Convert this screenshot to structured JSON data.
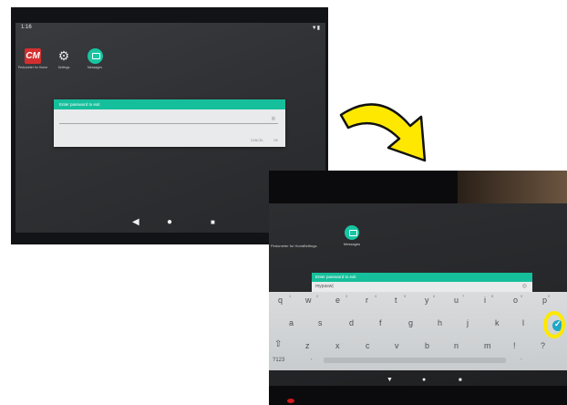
{
  "photo1": {
    "status_time": "1:16",
    "status_icons": "▼▮",
    "apps": [
      {
        "label": "Pedometer for Home",
        "icon": "cm-icon",
        "icon_text": "CM"
      },
      {
        "label": "Settings",
        "icon": "gear-icon"
      },
      {
        "label": "Messages",
        "icon": "message-icon"
      }
    ],
    "dialog": {
      "title": "Enter password to exit",
      "cancel_label": "CANCEL",
      "ok_label": "OK"
    },
    "nav": {
      "back": "◀",
      "home": "●",
      "recents": "■"
    }
  },
  "photo2": {
    "partial_labels": [
      "Pedometer for Home",
      "Settings"
    ],
    "messages_label": "Messages",
    "dialog": {
      "title": "Enter password to exit",
      "field_value": "mypasw|"
    },
    "keyboard": {
      "row1": [
        "q",
        "w",
        "e",
        "r",
        "t",
        "y",
        "u",
        "i",
        "o",
        "p"
      ],
      "row1_nums": [
        "1",
        "2",
        "3",
        "4",
        "5",
        "6",
        "7",
        "8",
        "9",
        "0"
      ],
      "row2": [
        "a",
        "s",
        "d",
        "f",
        "g",
        "h",
        "j",
        "k",
        "l"
      ],
      "row3": [
        "z",
        "x",
        "c",
        "v",
        "b",
        "n",
        "m",
        "!",
        "?"
      ],
      "shift": "⇧",
      "symbols": "?123",
      "comma": ",",
      "period": "."
    },
    "nav": {
      "back": "▼",
      "home": "●",
      "recents": "■"
    }
  },
  "colors": {
    "accent": "#16bf9b",
    "highlight": "#ffe800",
    "done_key": "#1ea7c6"
  }
}
